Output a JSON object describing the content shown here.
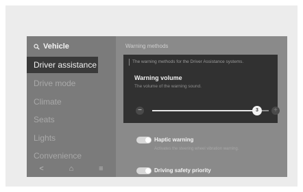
{
  "sidebar": {
    "title": "Vehicle",
    "items": [
      {
        "label": "Driver assistance"
      },
      {
        "label": "Drive mode"
      },
      {
        "label": "Climate"
      },
      {
        "label": "Seats"
      },
      {
        "label": "Lights"
      },
      {
        "label": "Convenience"
      }
    ],
    "bottom": {
      "back": "<",
      "home": "⌂",
      "menu": "≡"
    }
  },
  "main": {
    "title": "Warning methods",
    "panel": {
      "description": "The warning methods for the Driver Assistance systems.",
      "title": "Warning volume",
      "subtitle": "The volume of the warning sound.",
      "slider": {
        "minus": "−",
        "plus": "+",
        "value": "3",
        "fraction": 0.9
      }
    },
    "haptic": {
      "label": "Haptic warning",
      "subtitle": "Activates the steering wheel vibration warning.",
      "on": true
    },
    "driving_safety": {
      "label": "Driving safety priority",
      "on": true
    }
  }
}
